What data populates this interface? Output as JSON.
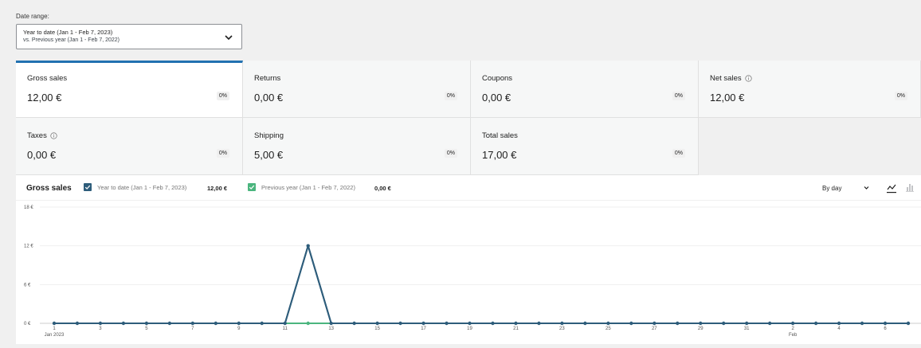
{
  "date_range": {
    "label": "Date range:",
    "line1": "Year to date (Jan 1 - Feb 7, 2023)",
    "line2": "vs. Previous year (Jan 1 - Feb 7, 2022)"
  },
  "tiles": [
    {
      "label": "Gross sales",
      "value": "12,00 €",
      "delta": "0%",
      "info": false,
      "selected": true
    },
    {
      "label": "Returns",
      "value": "0,00 €",
      "delta": "0%",
      "info": false,
      "selected": false
    },
    {
      "label": "Coupons",
      "value": "0,00 €",
      "delta": "0%",
      "info": false,
      "selected": false
    },
    {
      "label": "Net sales",
      "value": "12,00 €",
      "delta": "0%",
      "info": true,
      "selected": false
    },
    {
      "label": "Taxes",
      "value": "0,00 €",
      "delta": "0%",
      "info": true,
      "selected": false
    },
    {
      "label": "Shipping",
      "value": "5,00 €",
      "delta": "0%",
      "info": false,
      "selected": false
    },
    {
      "label": "Total sales",
      "value": "17,00 €",
      "delta": "0%",
      "info": false,
      "selected": false
    }
  ],
  "chart_header": {
    "title": "Gross sales",
    "legend_primary": "Year to date (Jan 1 - Feb 7, 2023)",
    "legend_primary_total": "12,00 €",
    "legend_secondary": "Previous year (Jan 1 - Feb 7, 2022)",
    "legend_secondary_total": "0,00 €",
    "interval": "By day"
  },
  "colors": {
    "primary": "#2e5d7b",
    "secondary": "#4bb57e",
    "accent": "#2271b1"
  },
  "chart_data": {
    "type": "line",
    "ylim": [
      0,
      18
    ],
    "y_ticks": [
      "0 €",
      "6 €",
      "12 €",
      "18 €"
    ],
    "y_tick_values": [
      0,
      6,
      12,
      18
    ],
    "x_tick_labels": [
      {
        "index": 0,
        "label": "1",
        "sub": "Jan 2023"
      },
      {
        "index": 2,
        "label": "3"
      },
      {
        "index": 4,
        "label": "5"
      },
      {
        "index": 6,
        "label": "7"
      },
      {
        "index": 8,
        "label": "9"
      },
      {
        "index": 10,
        "label": "11"
      },
      {
        "index": 12,
        "label": "13"
      },
      {
        "index": 14,
        "label": "15"
      },
      {
        "index": 16,
        "label": "17"
      },
      {
        "index": 18,
        "label": "19"
      },
      {
        "index": 20,
        "label": "21"
      },
      {
        "index": 22,
        "label": "23"
      },
      {
        "index": 24,
        "label": "25"
      },
      {
        "index": 26,
        "label": "27"
      },
      {
        "index": 28,
        "label": "29"
      },
      {
        "index": 30,
        "label": "31"
      },
      {
        "index": 32,
        "label": "2",
        "sub": "Feb"
      },
      {
        "index": 34,
        "label": "4"
      },
      {
        "index": 36,
        "label": "6"
      }
    ],
    "x": [
      "Jan 1",
      "Jan 2",
      "Jan 3",
      "Jan 4",
      "Jan 5",
      "Jan 6",
      "Jan 7",
      "Jan 8",
      "Jan 9",
      "Jan 10",
      "Jan 11",
      "Jan 12",
      "Jan 13",
      "Jan 14",
      "Jan 15",
      "Jan 16",
      "Jan 17",
      "Jan 18",
      "Jan 19",
      "Jan 20",
      "Jan 21",
      "Jan 22",
      "Jan 23",
      "Jan 24",
      "Jan 25",
      "Jan 26",
      "Jan 27",
      "Jan 28",
      "Jan 29",
      "Jan 30",
      "Jan 31",
      "Feb 1",
      "Feb 2",
      "Feb 3",
      "Feb 4",
      "Feb 5",
      "Feb 6",
      "Feb 7"
    ],
    "series": [
      {
        "name": "Year to date (Jan 1 - Feb 7, 2023)",
        "values": [
          0,
          0,
          0,
          0,
          0,
          0,
          0,
          0,
          0,
          0,
          0,
          12,
          0,
          0,
          0,
          0,
          0,
          0,
          0,
          0,
          0,
          0,
          0,
          0,
          0,
          0,
          0,
          0,
          0,
          0,
          0,
          0,
          0,
          0,
          0,
          0,
          0,
          0
        ]
      },
      {
        "name": "Previous year (Jan 1 - Feb 7, 2022)",
        "values": [
          0,
          0,
          0,
          0,
          0,
          0,
          0,
          0,
          0,
          0,
          0,
          0,
          0,
          0,
          0,
          0,
          0,
          0,
          0,
          0,
          0,
          0,
          0,
          0,
          0,
          0,
          0,
          0,
          0,
          0,
          0,
          0,
          0,
          0,
          0,
          0,
          0,
          0
        ]
      }
    ],
    "grid": true
  }
}
